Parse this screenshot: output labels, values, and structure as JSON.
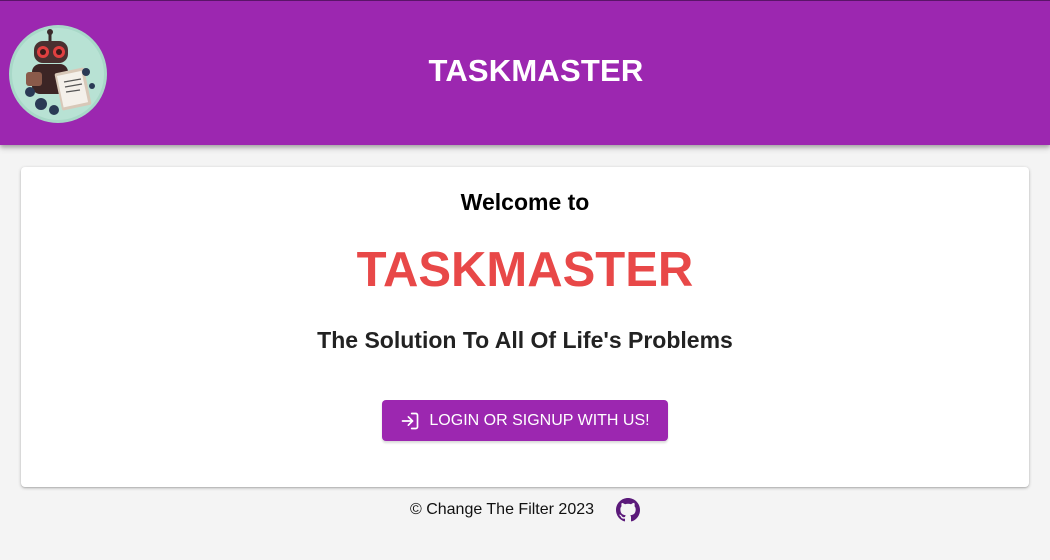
{
  "header": {
    "title": "TASKMASTER",
    "logo_icon": "robot-with-clipboard-icon",
    "background_color": "#9c27b0"
  },
  "hero": {
    "welcome": "Welcome to",
    "title": "TASKMASTER",
    "title_color": "#e84848",
    "tagline": "The Solution To All Of Life's Problems"
  },
  "login": {
    "label": "LOGIN OR SIGNUP WITH US!",
    "icon": "login-icon"
  },
  "footer": {
    "copyright": "© Change The Filter 2023",
    "github_icon": "github-icon",
    "github_color": "#5b1a7a"
  }
}
